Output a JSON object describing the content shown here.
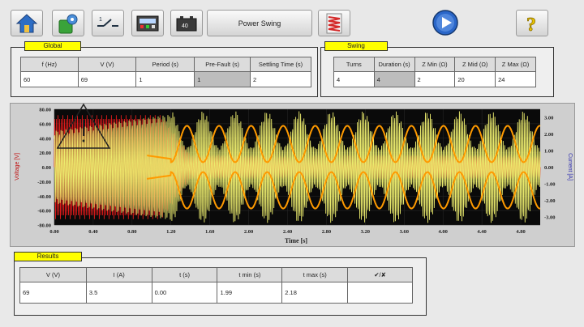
{
  "toolbar": {
    "power_swing_label": "Power Swing",
    "icons": [
      "home-icon",
      "settings-icon",
      "switch-icon",
      "meter-icon",
      "battery-icon",
      "oscillogram-icon",
      "play-icon",
      "help-icon"
    ],
    "battery_label": "40"
  },
  "global": {
    "tag": "Global",
    "headers": [
      "f (Hz)",
      "V (V)",
      "Period (s)",
      "Pre-Fault (s)",
      "Settling Time (s)"
    ],
    "values": [
      "60",
      "69",
      "1",
      "1",
      "2"
    ]
  },
  "swing": {
    "tag": "Swing",
    "headers": [
      "Turns",
      "Duration (s)",
      "Z Min (Ω)",
      "Z Mid (Ω)",
      "Z Max (Ω)"
    ],
    "values": [
      "4",
      "4",
      "2",
      "20",
      "24"
    ]
  },
  "results": {
    "tag": "Results",
    "headers": [
      "V (V)",
      "I (A)",
      "t (s)",
      "t min (s)",
      "t max (s)",
      "✔/✘"
    ],
    "values": [
      "69",
      "3.5",
      "0.00",
      "1.99",
      "2.18",
      ""
    ]
  },
  "chart_data": {
    "type": "line",
    "xlabel": "Time [s]",
    "ylabel_left": "Voltage [V]",
    "ylabel_right": "Current [A]",
    "x_ticks": [
      "0.00",
      "0.40",
      "0.80",
      "1.20",
      "1.60",
      "2.00",
      "2.40",
      "2.80",
      "3.20",
      "3.60",
      "4.00",
      "4.40",
      "4.80"
    ],
    "x_range": [
      0,
      5.0
    ],
    "left_ticks": [
      "80.00",
      "60.00",
      "40.00",
      "20.00",
      "0.00",
      "-20.00",
      "-40.00",
      "-60.00",
      "-80.00"
    ],
    "left_range": [
      -80,
      80
    ],
    "right_ticks": [
      "3.00",
      "2.00",
      "1.00",
      "0.00",
      "-1.00",
      "-2.00",
      "-3.00"
    ],
    "right_range": [
      -3.5,
      3.5
    ],
    "colors": {
      "background": "#0a0a0a",
      "voltage": "#e01a1a",
      "current": "#ecec6e",
      "envelope": "#ff9a00"
    },
    "series": [
      {
        "name": "Voltage [V]",
        "description": "60 Hz sine, amplitude ~69 V, prefault 0-1.2 s then decaying"
      },
      {
        "name": "Current [A]",
        "description": "60 Hz sine with swinging amplitude between ~0.9 A and ~3.5 A"
      }
    ]
  }
}
